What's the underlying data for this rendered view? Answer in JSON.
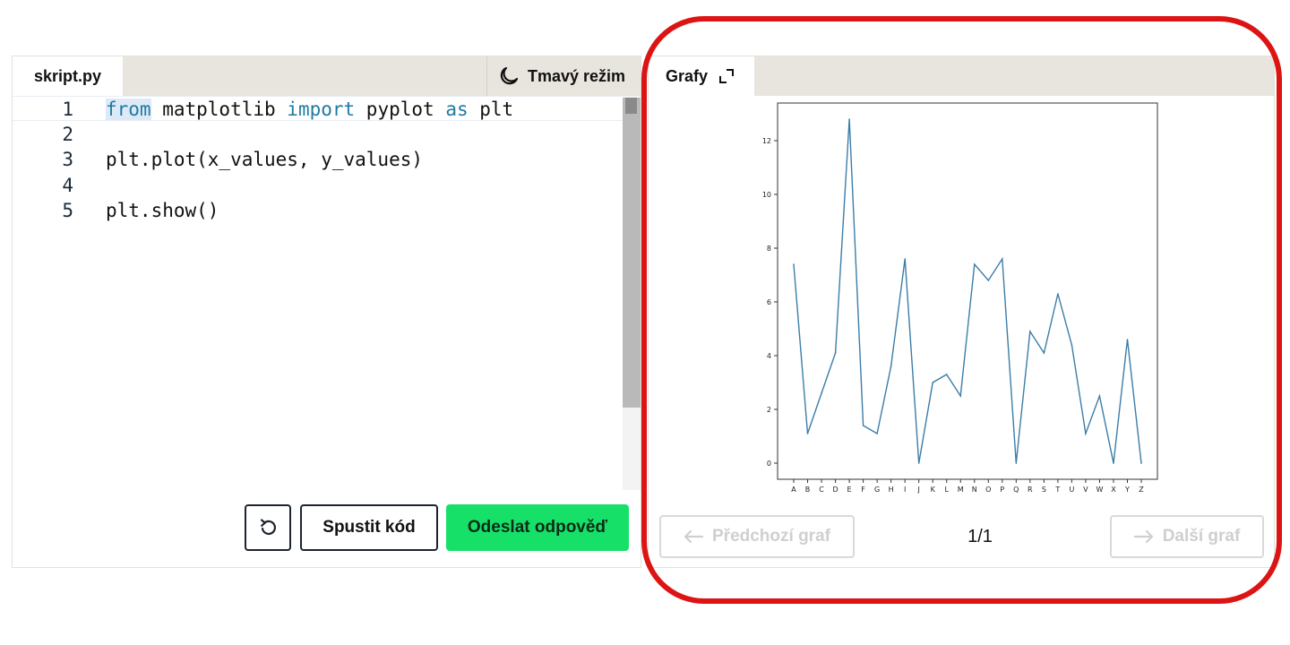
{
  "editor": {
    "file_tab": "skript.py",
    "theme_toggle": "Tmavý režim",
    "lines": [
      {
        "num": "1",
        "segments": [
          {
            "text": "from",
            "kind": "kw"
          },
          {
            "text": " matplotlib ",
            "kind": "plain"
          },
          {
            "text": "import",
            "kind": "kw"
          },
          {
            "text": " pyplot ",
            "kind": "plain"
          },
          {
            "text": "as",
            "kind": "kw"
          },
          {
            "text": " plt",
            "kind": "plain"
          }
        ]
      },
      {
        "num": "2",
        "segments": []
      },
      {
        "num": "3",
        "segments": [
          {
            "text": "plt.plot(x_values, y_values)",
            "kind": "plain"
          }
        ]
      },
      {
        "num": "4",
        "segments": []
      },
      {
        "num": "5",
        "segments": [
          {
            "text": "plt.show()",
            "kind": "plain"
          }
        ]
      }
    ],
    "actions": {
      "run_label": "Spustit kód",
      "submit_label": "Odeslat odpověď"
    }
  },
  "graphs": {
    "tab_label": "Grafy",
    "prev_label": "Předchozí graf",
    "next_label": "Další graf",
    "page_indicator": "1/1"
  },
  "colors": {
    "submit": "#17e069",
    "keyword": "#1f7aa0",
    "line": "#3b7da8",
    "highlight": "#dc1414"
  },
  "chart_data": {
    "type": "line",
    "categories": [
      "A",
      "B",
      "C",
      "D",
      "E",
      "F",
      "G",
      "H",
      "I",
      "J",
      "K",
      "L",
      "M",
      "N",
      "O",
      "P",
      "Q",
      "R",
      "S",
      "T",
      "U",
      "V",
      "W",
      "X",
      "Y",
      "Z"
    ],
    "values": [
      7.4,
      1.1,
      2.6,
      4.1,
      12.8,
      1.4,
      1.1,
      3.6,
      7.6,
      0.0,
      3.0,
      3.3,
      2.5,
      7.4,
      6.8,
      7.6,
      0.0,
      4.9,
      4.1,
      6.3,
      4.4,
      1.1,
      2.5,
      0.0,
      4.6,
      0.0
    ],
    "yticks": [
      0,
      2,
      4,
      6,
      8,
      10,
      12
    ],
    "ylim": [
      -0.6,
      13.4
    ],
    "title": "",
    "xlabel": "",
    "ylabel": ""
  }
}
